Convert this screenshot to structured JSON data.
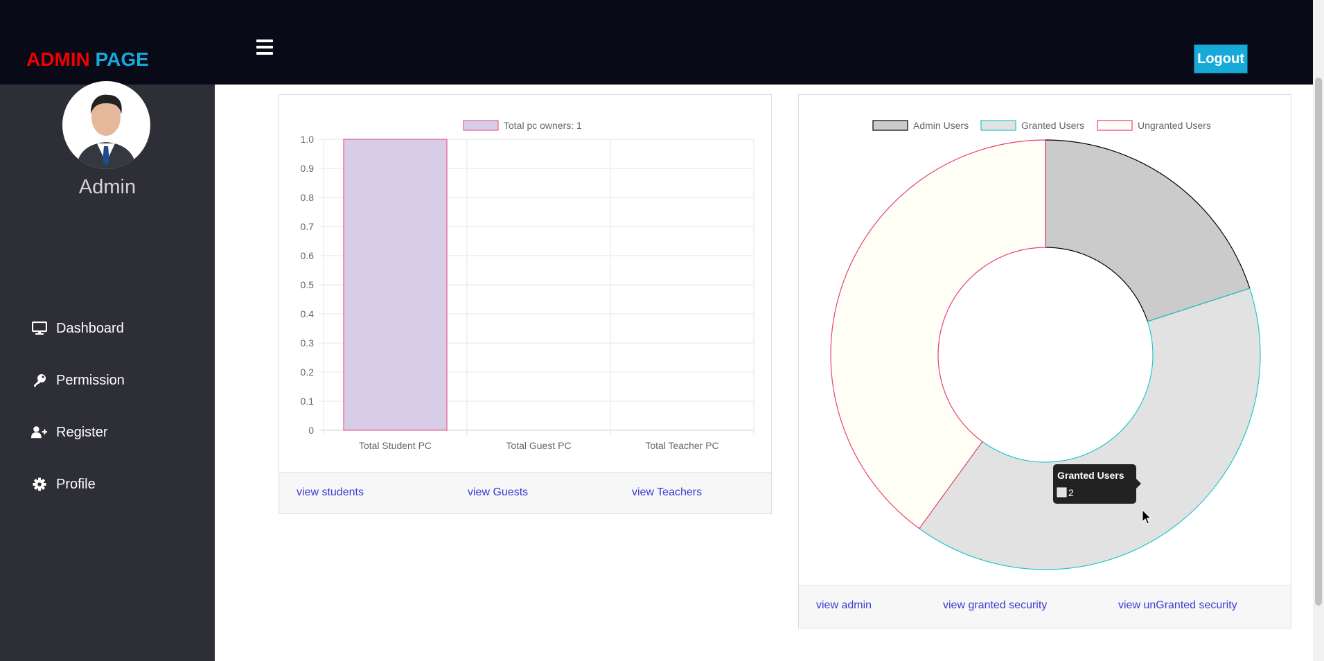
{
  "brand": {
    "part1": "ADMIN",
    "part2": "PAGE"
  },
  "header": {
    "logout_label": "Logout"
  },
  "sidebar": {
    "profile_name": "Admin",
    "items": [
      {
        "label": "Dashboard",
        "icon": "monitor-icon"
      },
      {
        "label": "Permission",
        "icon": "key-icon"
      },
      {
        "label": "Register",
        "icon": "user-plus-icon"
      },
      {
        "label": "Profile",
        "icon": "gear-icon"
      }
    ]
  },
  "colors": {
    "topbar": "#080a18",
    "sidebar": "#2e2e36",
    "brand_red": "#f00000",
    "brand_blue": "#17a9d8",
    "link": "#3b3bd4"
  },
  "bar_card": {
    "footer_links": [
      "view students",
      "view Guests",
      "view Teachers"
    ]
  },
  "donut_card": {
    "footer_links": [
      "view admin",
      "view granted security",
      "view unGranted security"
    ],
    "tooltip": {
      "title": "Granted Users",
      "value": "2"
    }
  },
  "chart_data": [
    {
      "type": "bar",
      "categories": [
        "Total Student PC",
        "Total Guest PC",
        "Total Teacher PC"
      ],
      "series": [
        {
          "name": "Total pc owners: 1",
          "values": [
            1,
            0,
            0
          ],
          "fill": "#d8cde6",
          "stroke": "#e83e7c"
        }
      ],
      "ylim": [
        0,
        1
      ],
      "yticks": [
        "0",
        "0.1",
        "0.2",
        "0.3",
        "0.4",
        "0.5",
        "0.6",
        "0.7",
        "0.8",
        "0.9",
        "1.0"
      ],
      "grid": true,
      "legend": "top"
    },
    {
      "type": "pie",
      "donut": true,
      "labels": [
        "Admin Users",
        "Granted Users",
        "Ungranted Users"
      ],
      "values": [
        1,
        2,
        2
      ],
      "fills": [
        "#cbcbcb",
        "#e2e2e2",
        "#fffff6"
      ],
      "strokes": [
        "#000000",
        "#20c6cf",
        "#e83e7c"
      ],
      "legend": "top"
    }
  ]
}
